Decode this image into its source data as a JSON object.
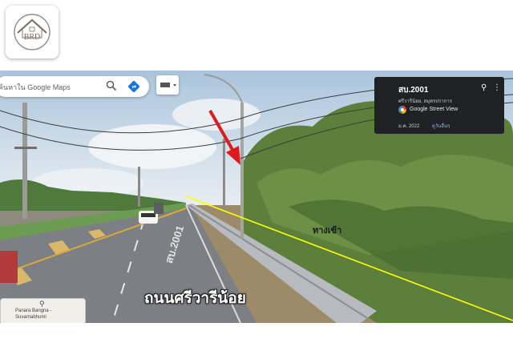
{
  "logo": {
    "text": "BRD"
  },
  "maps": {
    "search_text": "ค้นหาใน Google Maps"
  },
  "info_card": {
    "title": "สบ.2001",
    "subtitle": "ศรีวารีน้อย, สมุทรปราการ",
    "service": "Google Street View",
    "date": "ม.ค. 2022",
    "more_link": "ดูวันอื่นๆ"
  },
  "minimap": {
    "label_line1": "Panara Bangna -",
    "label_line2": "Suvarnabhumi"
  },
  "road_name": "ถนนศรีวารีน้อย",
  "road_paint_text": "สบ.2001",
  "overlay_label": "ทางเข้า",
  "colors": {
    "boundary_line": "#ffff00",
    "arrow": "#e01a1a",
    "info_card_bg": "#202124"
  }
}
